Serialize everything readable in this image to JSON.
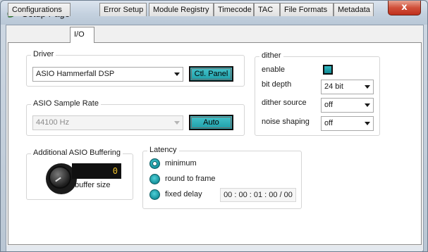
{
  "window": {
    "title": "Setup Page",
    "close_glyph": "x",
    "icon": "app-leaf-icon"
  },
  "tabs": [
    {
      "label": "Configurations",
      "active": false
    },
    {
      "label": "I/O",
      "active": true
    },
    {
      "label": "Error Setup",
      "active": false
    },
    {
      "label": "Module Registry",
      "active": false
    },
    {
      "label": "Timecode",
      "active": false
    },
    {
      "label": "TAC",
      "active": false
    },
    {
      "label": "File Formats",
      "active": false
    },
    {
      "label": "Metadata",
      "active": false
    }
  ],
  "driver": {
    "group_label": "Driver",
    "selected": "ASIO Hammerfall DSP",
    "control_panel_button": "Ctl. Panel"
  },
  "sample_rate": {
    "group_label": "ASIO Sample Rate",
    "selected": "44100 Hz",
    "disabled": true,
    "auto_button": "Auto"
  },
  "buffering": {
    "group_label": "Additional ASIO Buffering",
    "value": "0",
    "caption": "buffer size"
  },
  "latency": {
    "group_label": "Latency",
    "options": [
      {
        "label": "minimum",
        "selected": true
      },
      {
        "label": "round to frame",
        "selected": false
      },
      {
        "label": "fixed delay",
        "selected": false
      }
    ],
    "fixed_delay_value": "00 : 00 : 01 : 00 / 00"
  },
  "dither": {
    "group_label": "dither",
    "enable_label": "enable",
    "enabled": true,
    "bit_depth_label": "bit depth",
    "bit_depth_value": "24 bit",
    "source_label": "dither source",
    "source_value": "off",
    "noise_shaping_label": "noise shaping",
    "noise_shaping_value": "off"
  },
  "colors": {
    "accent_teal": "#1e9ea8",
    "display_text": "#f0c22c",
    "close_red": "#c0301c"
  }
}
